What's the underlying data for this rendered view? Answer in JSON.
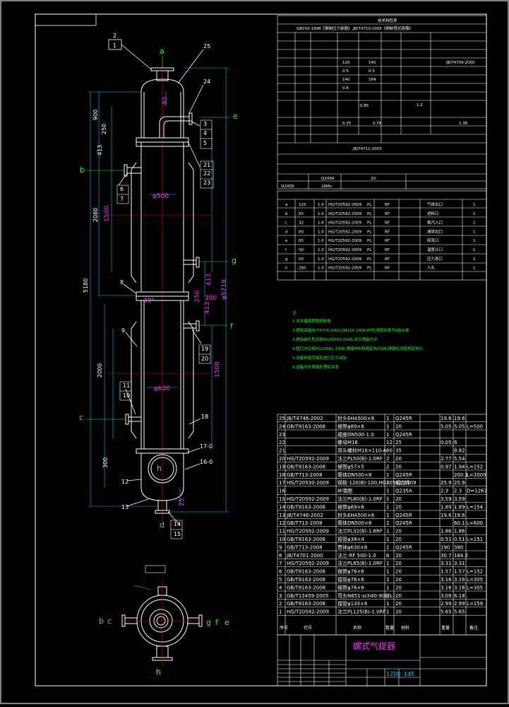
{
  "title_block": {
    "drawing_name": "螺式气提器",
    "scale": "1200",
    "sheet": "145"
  },
  "nozzle_labels": {
    "a": "a",
    "b": "b",
    "c": "c",
    "d": "d",
    "e": "e",
    "f": "f",
    "g": "g",
    "h": "h"
  },
  "part_callouts": [
    "2",
    "1",
    "25",
    "24",
    "3",
    "4",
    "5",
    "21",
    "22",
    "23",
    "6",
    "7",
    "8",
    "9",
    "11",
    "10",
    "19",
    "20",
    "18",
    "17-0",
    "16-0",
    "12",
    "13",
    "14",
    "15"
  ],
  "dimensions": {
    "magenta": [
      "85",
      "1500",
      "30°",
      "φ630",
      "1500",
      "413",
      "413",
      "390",
      "250",
      "25",
      "φ5716",
      "φ500"
    ],
    "white": [
      "900",
      "250",
      "413",
      "2080",
      "5180",
      "2000",
      "300"
    ]
  },
  "design_table": {
    "header": "技术特性表",
    "standard": "GB150-1998《钢制压力容器》,JB/T4710-2005《钢制塔式容器》",
    "ref_std": "JB/T4709-2000",
    "values": [
      "120",
      "140",
      "0.5",
      "0.5",
      "140",
      "164",
      "0.6",
      "0.85",
      "0.25",
      "0.76",
      "JB/T4711-2003",
      "1.2",
      "0.85",
      "1.36",
      "Q245R",
      "20",
      "Q245R",
      "16Mn"
    ]
  },
  "nozzle_table": {
    "rows": [
      {
        "mark": "a",
        "dn": "125",
        "pn": "1.0",
        "std": "HG/T20592-2009",
        "face": "PL",
        "type": "RF",
        "use": "气体出口",
        "qty": "1"
      },
      {
        "mark": "b",
        "dn": "65",
        "pn": "1.0",
        "std": "HG/T20592-2009",
        "face": "PL",
        "type": "RF",
        "use": "进料口",
        "qty": "1"
      },
      {
        "mark": "c",
        "dn": "32",
        "pn": "1.6",
        "std": "HG/T20592-2009",
        "face": "PL",
        "type": "RF",
        "use": "蒸汽入口",
        "qty": "1"
      },
      {
        "mark": "d",
        "dn": "80",
        "pn": "1.0",
        "std": "HG/T20592-2009",
        "face": "PL",
        "type": "RF",
        "use": "液体出口",
        "qty": "1"
      },
      {
        "mark": "e",
        "dn": "65",
        "pn": "1.0",
        "std": "HG/T20592-2009",
        "face": "PL",
        "type": "RF",
        "use": "回流口",
        "qty": "1"
      },
      {
        "mark": "f",
        "dn": "50",
        "pn": "1.0",
        "std": "HG/T20592-2009",
        "face": "PL",
        "type": "RF",
        "use": "温度计口",
        "qty": "1"
      },
      {
        "mark": "g",
        "dn": "50",
        "pn": "1.0",
        "std": "HG/T20592-2009",
        "face": "PL",
        "type": "RF",
        "use": "压力表口",
        "qty": "1"
      },
      {
        "mark": "h",
        "dn": "250",
        "pn": "1.0",
        "std": "HG/T20592-2009",
        "face": "PL",
        "type": "RF",
        "use": "人孔",
        "qty": "1"
      }
    ]
  },
  "notes": [
    "注",
    "1.本设备按照图纸制造",
    "2.焊接采用JB/T4709-2000,GB150-1998,RT检测按合格为II级合格",
    "3.焊接接头型式按HG20583-1998,法兰焊接方式",
    "4.管口方位按HG20581-1998,焊接材料按规定执行GB,焊缝检测按规定执行",
    "5.设备制造完成后进行压力试验",
    "6.设备内外表面处理后涂漆"
  ],
  "parts_list": [
    {
      "no": "25",
      "std": "JB/T4746-2002",
      "name": "封头EHA500×8",
      "qty": "1",
      "mat": "Q245R",
      "w1": "19.6",
      "w2": "19.6",
      "note": ""
    },
    {
      "no": "24",
      "std": "GB/T8163-2008",
      "name": "接管φ89×6",
      "qty": "1",
      "mat": "20",
      "w1": "5.05",
      "w2": "5.05",
      "note": "L=500"
    },
    {
      "no": "23",
      "std": "",
      "name": "裙座DN500-1.0",
      "qty": "1",
      "mat": "Q245R",
      "w1": "",
      "w2": "",
      "note": ""
    },
    {
      "no": "22",
      "std": "",
      "name": "螺母M16",
      "qty": "12",
      "mat": "25",
      "w1": "0.05",
      "w2": "6",
      "note": ""
    },
    {
      "no": "21",
      "std": "",
      "name": "双头螺柱M16×110-A",
      "qty": "60",
      "mat": "35",
      "w1": "",
      "w2": "8.82",
      "note": ""
    },
    {
      "no": "20",
      "std": "HG/T20592-2009",
      "name": "法兰PL50(B)-1.0RF",
      "qty": "2",
      "mat": "20",
      "w1": "2.77",
      "w2": "5.54",
      "note": ""
    },
    {
      "no": "19",
      "std": "GB/T8163-2008",
      "name": "接管φ57×5",
      "qty": "2",
      "mat": "20",
      "w1": "0.97",
      "w2": "1.94",
      "note": "L=152"
    },
    {
      "no": "18",
      "std": "GB/T713-2008",
      "name": "筒体DN500×8",
      "qty": "1",
      "mat": "Q245R",
      "w1": "",
      "w2": "200.1",
      "note": "L=2000"
    },
    {
      "no": "17",
      "std": "HG/T20530-2009",
      "name": "钢板-120(B)-100,HG20592-2009",
      "qty": "1",
      "mat": "组合件",
      "w1": "25.9",
      "w2": "25.9",
      "note": ""
    },
    {
      "no": "16",
      "std": "",
      "name": "补强圈",
      "qty": "1",
      "mat": "Q235A",
      "w1": "2.3",
      "w2": "2.3",
      "note": "D=1267"
    },
    {
      "no": "15",
      "std": "HG/T20592-2009",
      "name": "法兰PL80(B)-1.0RF",
      "qty": "1",
      "mat": "20",
      "w1": "3.59",
      "w2": "3.59",
      "note": ""
    },
    {
      "no": "14",
      "std": "GB/T8163-2008",
      "name": "接管φ89×6",
      "qty": "1",
      "mat": "20",
      "w1": "1.89",
      "w2": "1.89",
      "note": "L=154"
    },
    {
      "no": "13",
      "std": "JB/T4746-2002",
      "name": "封头EHA500×8",
      "qty": "1",
      "mat": "Q245R",
      "w1": "19.6",
      "w2": "19.6",
      "note": ""
    },
    {
      "no": "12",
      "std": "GB/T713-2008",
      "name": "筒体DN500×8",
      "qty": "1",
      "mat": "Q245R",
      "w1": "",
      "w2": "60.1",
      "note": "L=600"
    },
    {
      "no": "11",
      "std": "HG/T20592-2009",
      "name": "法兰PL32(B)-1.6RF",
      "qty": "1",
      "mat": "20",
      "w1": "1.86",
      "w2": "1.86",
      "note": ""
    },
    {
      "no": "10",
      "std": "GB/T8163-2008",
      "name": "接管φ38×4",
      "qty": "1",
      "mat": "20",
      "w1": "0.51",
      "w2": "0.51",
      "note": "L=151"
    },
    {
      "no": "9",
      "std": "GB/T713-2008",
      "name": "筒体φ630×8",
      "qty": "2",
      "mat": "Q245R",
      "w1": "190",
      "w2": "380",
      "note": ""
    },
    {
      "no": "8",
      "std": "JB/T4701-2000",
      "name": "法兰-RF 500-1.0",
      "qty": "6",
      "mat": "20",
      "w1": "30.7",
      "w2": "184.2",
      "note": ""
    },
    {
      "no": "7",
      "std": "HG/T20592-2009",
      "name": "法兰PL65(B)-1.0RF",
      "qty": "1",
      "mat": "20",
      "w1": "3.31",
      "w2": "3.31",
      "note": ""
    },
    {
      "no": "6",
      "std": "GB/T8163-2008",
      "name": "接管φ76×6",
      "qty": "1",
      "mat": "20",
      "w1": "1.57",
      "w2": "1.57",
      "note": "L=152"
    },
    {
      "no": "5",
      "std": "GB/T8163-2008",
      "name": "接管φ76×6",
      "qty": "1",
      "mat": "20",
      "w1": "3.16",
      "w2": "3.16",
      "note": "L=305"
    },
    {
      "no": "4",
      "std": "GB/T8163-2008",
      "name": "接管φ76×6",
      "qty": "1",
      "mat": "20",
      "w1": "3.16",
      "w2": "3.16",
      "note": "L=305"
    },
    {
      "no": "3",
      "std": "GB/T12459-2005",
      "name": "弯头N651-sch40-90E(L)",
      "qty": "2",
      "mat": "20",
      "w1": "3.09",
      "w2": "6.18",
      "note": ""
    },
    {
      "no": "2",
      "std": "GB/T8163-2008",
      "name": "接管φ133×6",
      "qty": "1",
      "mat": "20",
      "w1": "2.99",
      "w2": "2.99",
      "note": "L=159"
    },
    {
      "no": "1",
      "std": "HG/T20592-2009",
      "name": "法兰PL125(B)-1.0RF",
      "qty": "1",
      "mat": "20",
      "w1": "5.65",
      "w2": "5.65",
      "note": ""
    }
  ],
  "parts_header": {
    "no": "序号",
    "std": "代号",
    "name": "名称",
    "qty": "数量",
    "mat": "材料",
    "weight": "重量",
    "note": "备注"
  }
}
